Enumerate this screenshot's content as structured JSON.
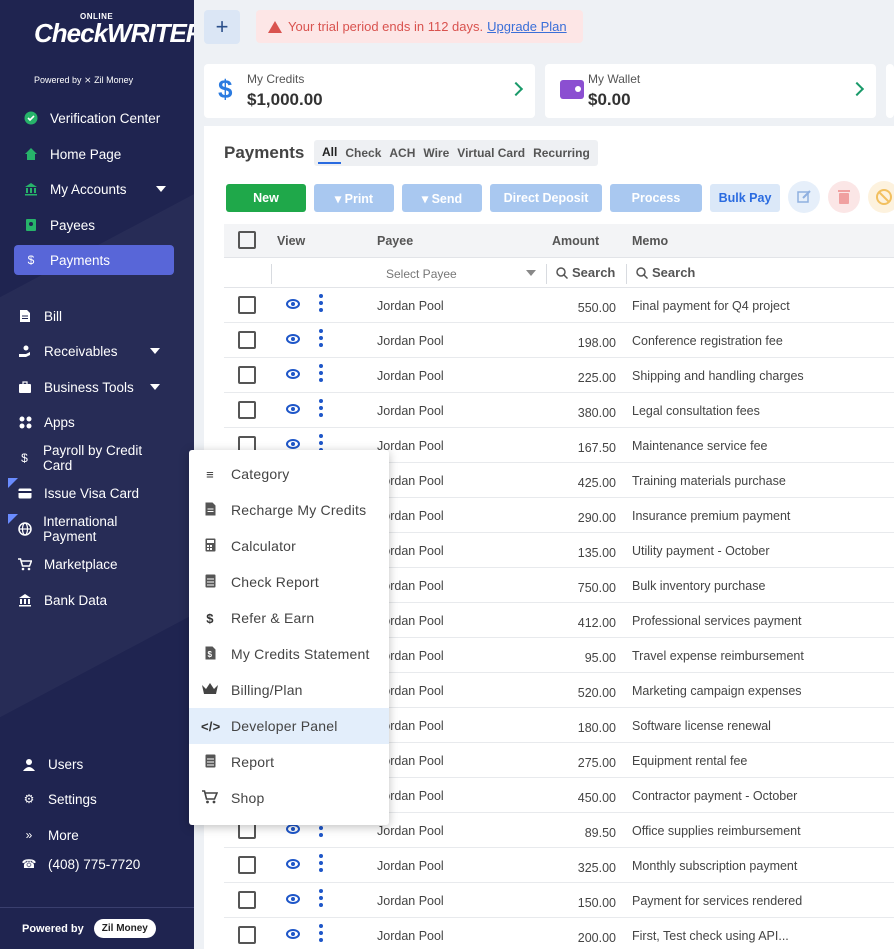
{
  "brand": {
    "online": "ONLINE",
    "name": "CheckWRITER",
    "powered": "Powered by ⨯ Zil Money"
  },
  "sidebar": {
    "items": [
      {
        "label": "Verification Center",
        "icon": "check-circle-icon"
      },
      {
        "label": "Home Page",
        "icon": "home-icon"
      },
      {
        "label": "My Accounts",
        "icon": "bank-icon"
      },
      {
        "label": "Payees",
        "icon": "contact-icon"
      },
      {
        "label": "Payments",
        "icon": "dollar-icon"
      },
      {
        "label": "Bill",
        "icon": "document-icon"
      },
      {
        "label": "Receivables",
        "icon": "hand-coin-icon"
      },
      {
        "label": "Business Tools",
        "icon": "briefcase-icon"
      },
      {
        "label": "Apps",
        "icon": "grid-icon"
      },
      {
        "label": "Payroll by Credit Card",
        "icon": "dollar-icon"
      },
      {
        "label": "Issue Visa Card",
        "icon": "card-icon"
      },
      {
        "label": "International Payment",
        "icon": "globe-icon"
      },
      {
        "label": "Marketplace",
        "icon": "cart-icon"
      },
      {
        "label": "Bank Data",
        "icon": "bank-icon"
      },
      {
        "label": "Users",
        "icon": "user-icon"
      },
      {
        "label": "Settings",
        "icon": "gear-icon"
      },
      {
        "label": "More",
        "icon": "double-chevron-icon"
      },
      {
        "label": "(408) 775-7720",
        "icon": "phone-icon"
      }
    ],
    "footer_label": "Powered by",
    "footer_brand": "Zil Money"
  },
  "topbar": {
    "trial_text": "Your trial period ends in 112 days.",
    "upgrade_link": "Upgrade Plan"
  },
  "cards": [
    {
      "label": "My Credits",
      "value": "$1,000.00"
    },
    {
      "label": "My Wallet",
      "value": "$0.00"
    }
  ],
  "payments": {
    "title": "Payments",
    "tabs": [
      "All",
      "Check",
      "ACH",
      "Wire",
      "Virtual Card",
      "Recurring"
    ],
    "buttons": {
      "new": "New",
      "print": "▾ Print",
      "send": "▾ Send",
      "direct_deposit": "Direct Deposit",
      "process": "Process",
      "bulk_pay": "Bulk Pay"
    },
    "columns": [
      "View",
      "Payee",
      "Amount",
      "Memo"
    ],
    "filters": {
      "payee_placeholder": "Select Payee",
      "amount_search": "Search",
      "memo_search": "Search"
    },
    "rows": [
      {
        "payee": "Jordan Pool",
        "amount": "550.00",
        "memo": "Final payment for Q4 project"
      },
      {
        "payee": "Jordan Pool",
        "amount": "198.00",
        "memo": "Conference registration fee"
      },
      {
        "payee": "Jordan Pool",
        "amount": "225.00",
        "memo": "Shipping and handling charges"
      },
      {
        "payee": "Jordan Pool",
        "amount": "380.00",
        "memo": "Legal consultation fees"
      },
      {
        "payee": "Jordan Pool",
        "amount": "167.50",
        "memo": "Maintenance service fee"
      },
      {
        "payee": "Jordan Pool",
        "amount": "425.00",
        "memo": "Training materials purchase"
      },
      {
        "payee": "Jordan Pool",
        "amount": "290.00",
        "memo": "Insurance premium payment"
      },
      {
        "payee": "Jordan Pool",
        "amount": "135.00",
        "memo": "Utility payment - October"
      },
      {
        "payee": "Jordan Pool",
        "amount": "750.00",
        "memo": "Bulk inventory purchase"
      },
      {
        "payee": "Jordan Pool",
        "amount": "412.00",
        "memo": "Professional services payment"
      },
      {
        "payee": "Jordan Pool",
        "amount": "95.00",
        "memo": "Travel expense reimbursement"
      },
      {
        "payee": "Jordan Pool",
        "amount": "520.00",
        "memo": "Marketing campaign expenses"
      },
      {
        "payee": "Jordan Pool",
        "amount": "180.00",
        "memo": "Software license renewal"
      },
      {
        "payee": "Jordan Pool",
        "amount": "275.00",
        "memo": "Equipment rental fee"
      },
      {
        "payee": "Jordan Pool",
        "amount": "450.00",
        "memo": "Contractor payment - October"
      },
      {
        "payee": "Jordan Pool",
        "amount": "89.50",
        "memo": "Office supplies reimbursement"
      },
      {
        "payee": "Jordan Pool",
        "amount": "325.00",
        "memo": "Monthly subscription payment"
      },
      {
        "payee": "Jordan Pool",
        "amount": "150.00",
        "memo": "Payment for services rendered"
      },
      {
        "payee": "Jordan Pool",
        "amount": "200.00",
        "memo": "First, Test check using API..."
      }
    ]
  },
  "menu": {
    "items": [
      {
        "label": "Category",
        "icon": "list-icon"
      },
      {
        "label": "Recharge My Credits",
        "icon": "document-icon"
      },
      {
        "label": "Calculator",
        "icon": "calculator-icon"
      },
      {
        "label": "Check Report",
        "icon": "report-icon"
      },
      {
        "label": "Refer & Earn",
        "icon": "dollar-icon"
      },
      {
        "label": "My Credits Statement",
        "icon": "statement-icon"
      },
      {
        "label": "Billing/Plan",
        "icon": "crown-icon"
      },
      {
        "label": "Developer Panel",
        "icon": "code-icon"
      },
      {
        "label": "Report",
        "icon": "report-icon"
      },
      {
        "label": "Shop",
        "icon": "cart-icon"
      }
    ],
    "highlighted": "Developer Panel"
  },
  "colors": {
    "sidebar_bg": "#1f2450",
    "active_nav": "#5866d8",
    "new_button": "#1fa84a",
    "link_blue": "#1e56c8",
    "trial_red": "#d9534f"
  }
}
